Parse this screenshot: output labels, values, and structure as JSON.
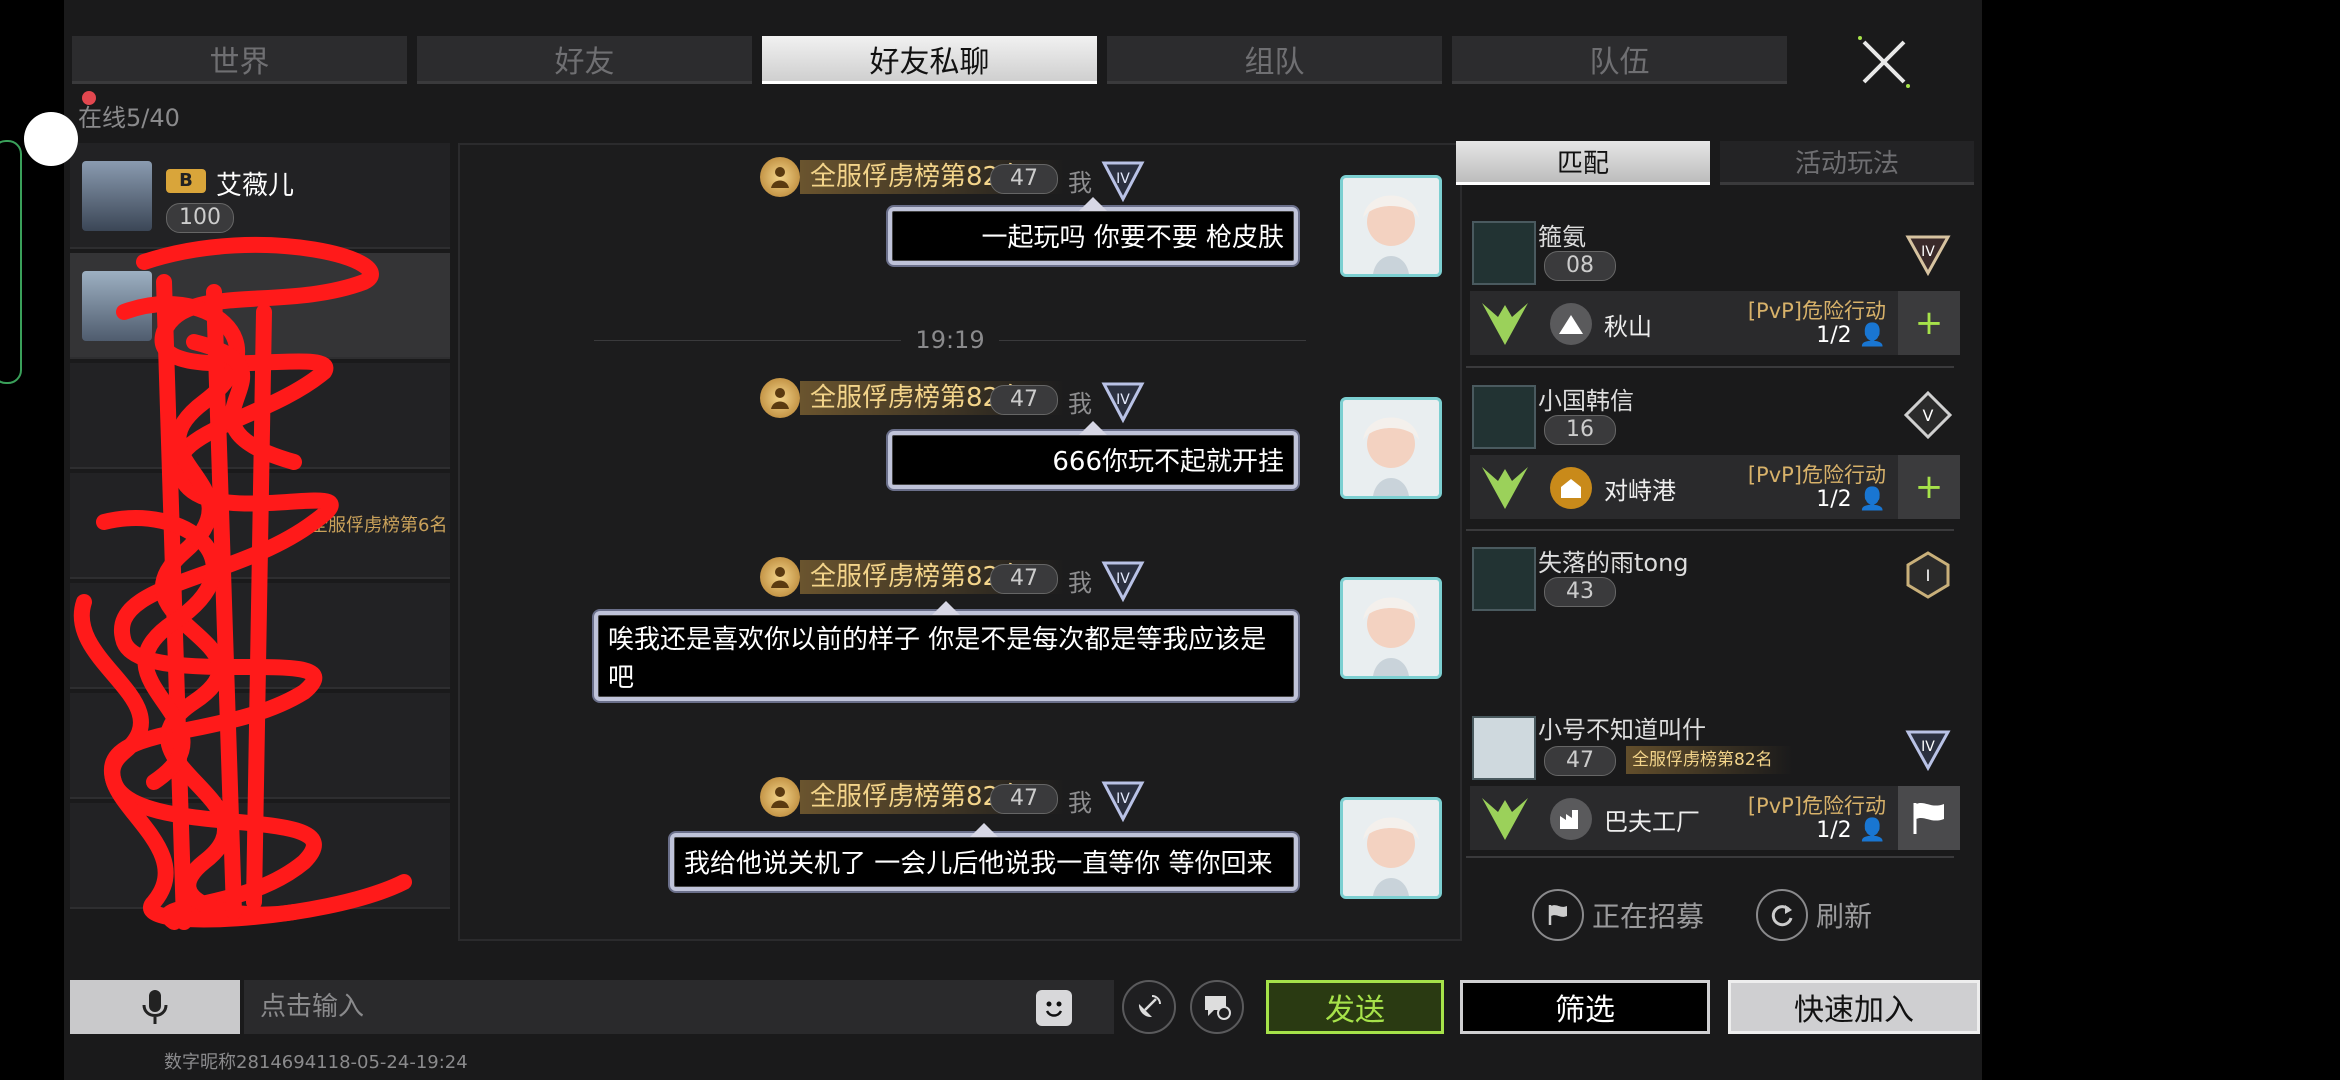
{
  "tabs": [
    "世界",
    "好友",
    "好友私聊",
    "组队",
    "队伍"
  ],
  "active_tab": "好友私聊",
  "online_count": "在线5/40",
  "friends": [
    {
      "name": "艾薇儿",
      "badge": "B",
      "level": "100"
    },
    {
      "name": "",
      "level": ""
    },
    {
      "name": "",
      "level": ""
    },
    {
      "name": "",
      "rank_title": "全服俘虏榜第6名"
    }
  ],
  "messages": [
    {
      "rank_title": "全服俘虏榜第82名",
      "level": "47",
      "sender": "我",
      "text": "一起玩吗 你要不要 枪皮肤"
    },
    {
      "rank_title": "全服俘虏榜第82名",
      "level": "47",
      "sender": "我",
      "text": "666你玩不起就开挂"
    },
    {
      "rank_title": "全服俘虏榜第82名",
      "level": "47",
      "sender": "我",
      "text": "唉我还是喜欢你以前的样子 你是不是每次都是等我应该是吧"
    },
    {
      "rank_title": "全服俘虏榜第82名",
      "level": "47",
      "sender": "我",
      "text": "我给他说关机了 一会儿后他说我一直等你 等你回来"
    }
  ],
  "time_separator": "19:19",
  "right_tabs": [
    "匹配",
    "活动玩法"
  ],
  "teams": [
    {
      "name": "箍氨",
      "level": "08",
      "rank": "IV",
      "map": "秋山",
      "mode": "[PvP]危险行动",
      "count": "1/2",
      "action": "+"
    },
    {
      "name": "小国韩信",
      "level": "16",
      "rank": "V",
      "map": "对峙港",
      "mode": "[PvP]危险行动",
      "count": "1/2",
      "action": "+"
    },
    {
      "name": "失落的雨tong",
      "level": "43",
      "rank": "I"
    },
    {
      "name": "小号不知道叫什",
      "level": "47",
      "rank_title": "全服俘虏榜第82名",
      "rank": "IV",
      "map": "巴夫工厂",
      "mode": "[PvP]危险行动",
      "count": "1/2",
      "action": "flag"
    }
  ],
  "recruiting_label": "正在招募",
  "refresh_label": "刷新",
  "input_placeholder": "点击输入",
  "send_label": "发送",
  "filter_label": "筛选",
  "quick_join_label": "快速加入",
  "watermark": "数字昵称2814694118-05-24-19:24",
  "colors": {
    "accent_green": "#a6e24a",
    "gold": "#f3d48a",
    "scribble_red": "#ff1a1a"
  }
}
